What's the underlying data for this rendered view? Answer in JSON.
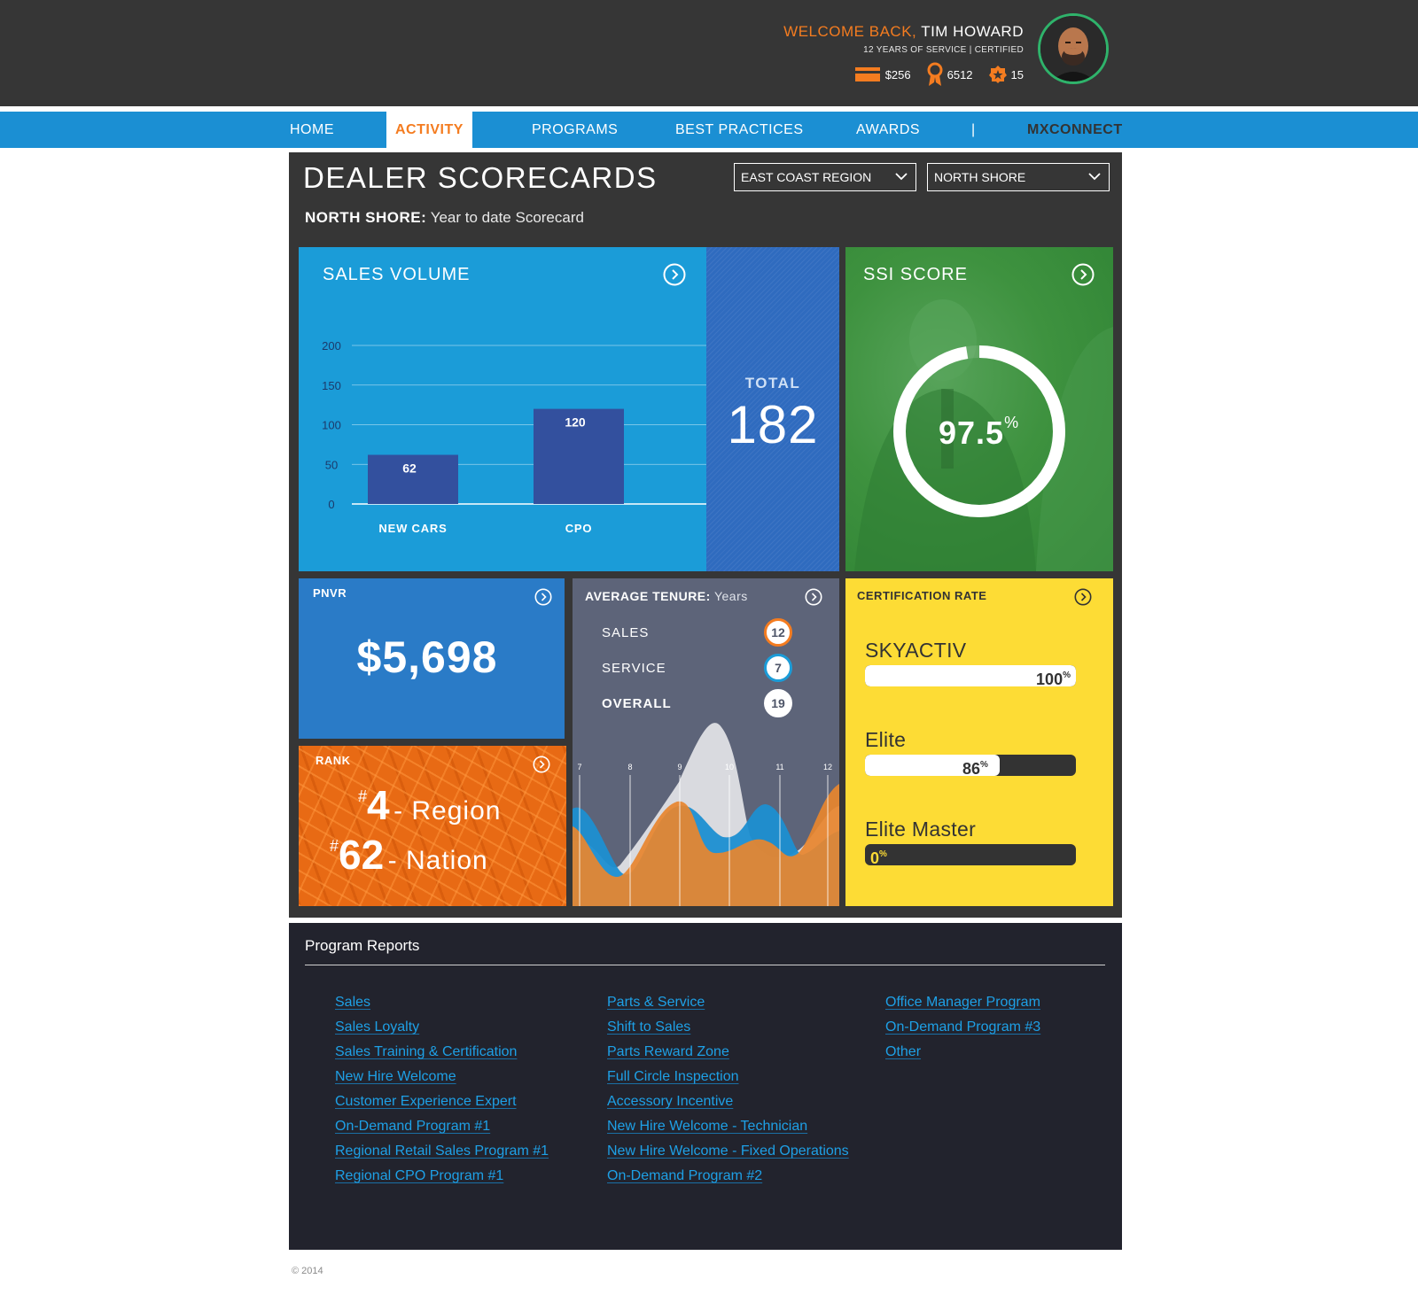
{
  "header": {
    "welcome_prefix": "WELCOME BACK,",
    "user_name": "TIM HOWARD",
    "service_line": "12 YEARS OF SERVICE | CERTIFIED",
    "stats": {
      "money": "$256",
      "points": "6512",
      "badges": "15"
    }
  },
  "nav": {
    "items": [
      "HOME",
      "ACTIVITY",
      "PROGRAMS",
      "BEST PRACTICES",
      "AWARDS",
      "|",
      "MXCONNECT"
    ],
    "active": "ACTIVITY"
  },
  "scorecard": {
    "title": "DEALER SCORECARDS",
    "subtitle_bold": "NORTH SHORE:",
    "subtitle_rest": " Year to date Scorecard",
    "region_select": "EAST COAST REGION",
    "dealer_select": "NORTH SHORE"
  },
  "sales_volume": {
    "title": "SALES VOLUME",
    "total_label": "TOTAL",
    "total_value": "182"
  },
  "chart_data": {
    "type": "bar",
    "categories": [
      "NEW CARS",
      "CPO"
    ],
    "values": [
      62,
      120
    ],
    "data_labels": [
      "62",
      "120"
    ],
    "yticks": [
      "200",
      "150",
      "100",
      "50",
      "0"
    ],
    "ylim": [
      0,
      200
    ],
    "grid": true
  },
  "ssi": {
    "title": "SSI SCORE",
    "value": "97.5",
    "unit": "%",
    "fraction": 0.975
  },
  "pnvr": {
    "title": "PNVR",
    "value": "$5,698"
  },
  "rank": {
    "title": "RANK",
    "region_number": "4",
    "region_label": "- Region",
    "nation_number": "62",
    "nation_label": "- Nation",
    "hash": "#"
  },
  "tenure": {
    "title_bold": "AVERAGE TENURE:",
    "title_rest": " Years",
    "rows": [
      {
        "label": "SALES",
        "value": "12",
        "color": "#f47c20"
      },
      {
        "label": "SERVICE",
        "value": "7",
        "color": "#1b9cd8"
      },
      {
        "label": "OVERALL",
        "value": "19",
        "color": "#ffffff"
      }
    ],
    "months": [
      "7",
      "8",
      "9",
      "10",
      "11",
      "12"
    ]
  },
  "certification": {
    "title": "CERTIFICATION RATE",
    "items": [
      {
        "label": "SKYACTIV",
        "value": "100",
        "fraction": 1.0
      },
      {
        "label": "Elite",
        "value": "86",
        "fraction": 0.64
      },
      {
        "label": "Elite Master",
        "value": "0",
        "fraction": 0.0
      }
    ],
    "unit": "%"
  },
  "reports": {
    "title": "Program Reports",
    "col1": [
      "Sales",
      "Sales Loyalty",
      "Sales Training & Certification",
      "New Hire Welcome",
      "Customer Experience Expert",
      "On-Demand Program #1",
      "Regional Retail Sales Program #1",
      "Regional CPO Program #1"
    ],
    "col2": [
      "Parts & Service",
      "Shift to Sales",
      "Parts Reward Zone",
      "Full Circle Inspection",
      "Accessory Incentive",
      "New Hire  Welcome - Technician",
      "New Hire Welcome - Fixed Operations",
      "On-Demand Program #2"
    ],
    "col3": [
      "Office Manager Program",
      "On-Demand Program #3",
      "Other"
    ]
  },
  "footer": {
    "copyright": "© 2014"
  },
  "colors": {
    "accent": "#f47c20",
    "nav": "#1b8fd3",
    "sales": "#1b9cd8",
    "ssi": "#3e923f",
    "cert": "#fddc35"
  }
}
